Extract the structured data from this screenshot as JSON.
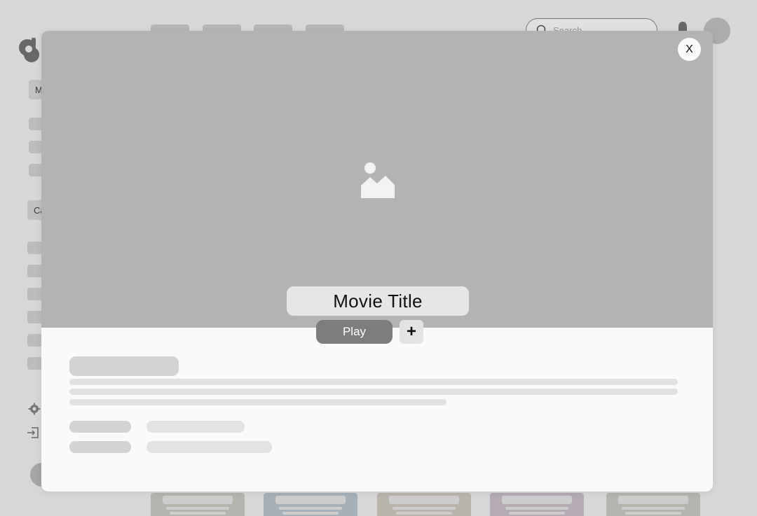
{
  "header": {
    "search_placeholder": "Search"
  },
  "sidebar": {
    "section_1_label": "M",
    "section_2_label": "Ca"
  },
  "modal": {
    "title": "Movie Title",
    "play_label": "Play",
    "add_label": "+",
    "close_label": "X"
  },
  "colors": {
    "hero_bg": "#b3b3b3",
    "play_bg": "#7d7d7d",
    "modal_bg": "#fafafa"
  },
  "icons": {
    "hero": "image-placeholder-icon",
    "close": "close-icon",
    "add": "plus-icon",
    "search": "search-icon",
    "notifications": "bell-icon",
    "settings": "gear-icon",
    "logout": "logout-icon"
  }
}
